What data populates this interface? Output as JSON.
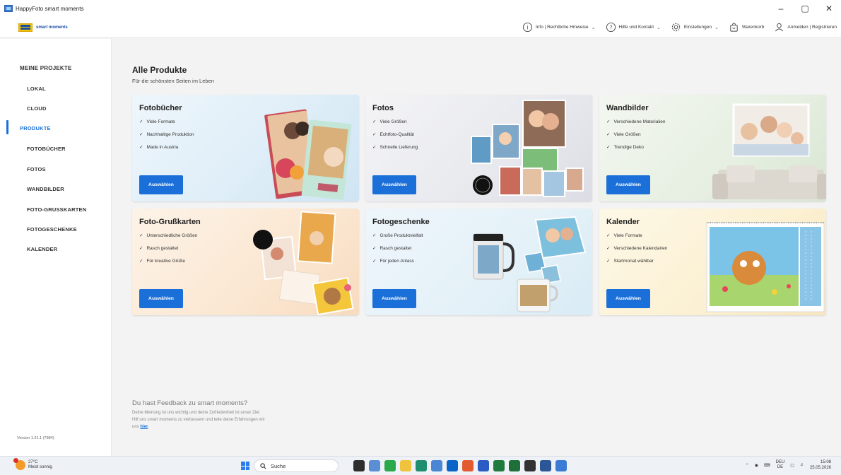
{
  "window": {
    "title": "HappyFoto smart moments",
    "controls": [
      "–",
      "▢",
      "✕"
    ]
  },
  "header": {
    "logo_text": "smart moments",
    "nav": [
      {
        "icon": "info-icon",
        "label": "Info | Rechtliche Hinweise",
        "has_dropdown": true
      },
      {
        "icon": "help-icon",
        "label": "Hilfe und Kontakt",
        "has_dropdown": true
      },
      {
        "icon": "gear-icon",
        "label": "Einstellungen",
        "has_dropdown": true
      },
      {
        "icon": "cart-icon",
        "label": "Warenkorb",
        "has_dropdown": false
      },
      {
        "icon": "user-icon",
        "label": "Anmelden | Registrieren",
        "has_dropdown": false
      }
    ]
  },
  "sidebar": {
    "section_meine": "MEINE PROJEKTE",
    "item_lokal": "LOKAL",
    "item_cloud": "CLOUD",
    "section_produkte": "PRODUKTE",
    "item_fotobuecher": "FOTOBÜCHER",
    "item_fotos": "FOTOS",
    "item_wandbilder": "WANDBILDER",
    "item_grusskarten": "FOTO-GRUSSKARTEN",
    "item_fotogeschenke": "FOTOGESCHENKE",
    "item_kalender": "KALENDER",
    "active": "PRODUKTE",
    "version": "Version 1.21.1 (7884)"
  },
  "main": {
    "title": "Alle Produkte",
    "subtitle": "Für die schönsten Seiten im Leben",
    "cards": [
      {
        "title": "Fotobücher",
        "features": [
          "Viele Formate",
          "Nachhaltige Produktion",
          "Made in Austria"
        ],
        "button": "Auswählen"
      },
      {
        "title": "Fotos",
        "features": [
          "Viele Größen",
          "Echtfoto-Qualität",
          "Schnelle Lieferung"
        ],
        "button": "Auswählen"
      },
      {
        "title": "Wandbilder",
        "features": [
          "Verschiedene Materialien",
          "Viele Größen",
          "Trendige Deko"
        ],
        "button": "Auswählen"
      },
      {
        "title": "Foto-Grußkarten",
        "features": [
          "Unterschiedliche Größen",
          "Rasch gestaltet",
          "Für kreative Grüße"
        ],
        "button": "Auswählen"
      },
      {
        "title": "Fotogeschenke",
        "features": [
          "Große Produktvielfalt",
          "Rasch gestaltet",
          "Für jeden Anlass"
        ],
        "button": "Auswählen"
      },
      {
        "title": "Kalender",
        "features": [
          "Viele Formate",
          "Verschiedene Kalendarien",
          "Startmonat wählbar"
        ],
        "button": "Auswählen"
      }
    ],
    "feedback": {
      "title": "Du hast Feedback zu smart moments?",
      "line1": "Deine Meinung ist uns wichtig und deine Zufriedenheit ist unser Ziel.",
      "line2": "Hilf uns smart moments zu verbessern und teile deine Erfahrungen mit",
      "line3_prefix": "uns",
      "link": "hier",
      "line3_suffix": "."
    }
  },
  "taskbar": {
    "weather_temp": "27°C",
    "weather_desc": "Meist sonnig",
    "search_label": "Suche",
    "lang_top": "DEU",
    "lang_bottom": "DE",
    "time": "15:08",
    "date": "25.05.2026"
  },
  "colors": {
    "accent": "#1a6fd8",
    "logo_yellow": "#f3c300",
    "logo_blue": "#1a4fa3"
  }
}
